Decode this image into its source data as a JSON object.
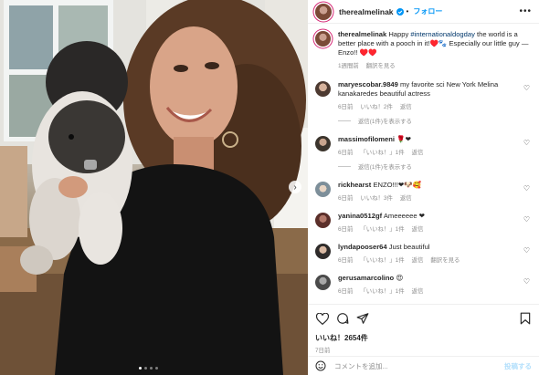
{
  "post": {
    "username": "therealmelinak",
    "follow_label": "フォロー",
    "caption_username": "therealmelinak",
    "caption_prefix": "Happy ",
    "caption_hashtag": "#internationaldogday",
    "caption_rest": " the world is a better place with a pooch in it!♥️🐾 Especially our little guy — Enzo!! ♥️♥️",
    "caption_time": "1週間前",
    "caption_translate": "翻訳を見る",
    "likes": "いいね！2654件",
    "posted_ago": "7日前"
  },
  "comments": [
    {
      "username": "maryescobar.9849",
      "text": "my favorite sci New York Melina kanakaredes beautiful actress",
      "time": "6日前",
      "likes": "いいね！2件",
      "reply": "返信",
      "replies": "返信(1件)を表示する"
    },
    {
      "username": "massimofilomeni",
      "text": "🌹❤",
      "time": "6日前",
      "likes": "「いいね！」1件",
      "reply": "返信",
      "replies": "返信(1件)を表示する"
    },
    {
      "username": "rickhearst",
      "text": "ENZO!!!❤🐶🥰",
      "time": "6日前",
      "likes": "いいね！3件",
      "reply": "返信"
    },
    {
      "username": "yanina0512gf",
      "text": "Ameeeeee ❤",
      "time": "6日前",
      "likes": "「いいね！」1件",
      "reply": "返信"
    },
    {
      "username": "lyndapooser64",
      "text": "Just beautiful",
      "time": "6日前",
      "likes": "「いいね！」1件",
      "reply": "返信",
      "translate": "翻訳を見る"
    },
    {
      "username": "gerusamarcolino",
      "text": "😍",
      "time": "6日前",
      "likes": "「いいね！」1件",
      "reply": "返信"
    }
  ],
  "composer": {
    "placeholder": "コメントを追加...",
    "post_label": "投稿する"
  },
  "carousel": {
    "slides": 4,
    "active_index": 0
  },
  "colors": {
    "accent": "#0095f6",
    "text": "#262626",
    "muted": "#8e8e8e"
  },
  "icons": [
    "verified-badge-icon",
    "more-options-icon",
    "heart-icon",
    "comment-icon",
    "share-icon",
    "bookmark-icon",
    "emoji-icon",
    "chevron-right-icon"
  ]
}
